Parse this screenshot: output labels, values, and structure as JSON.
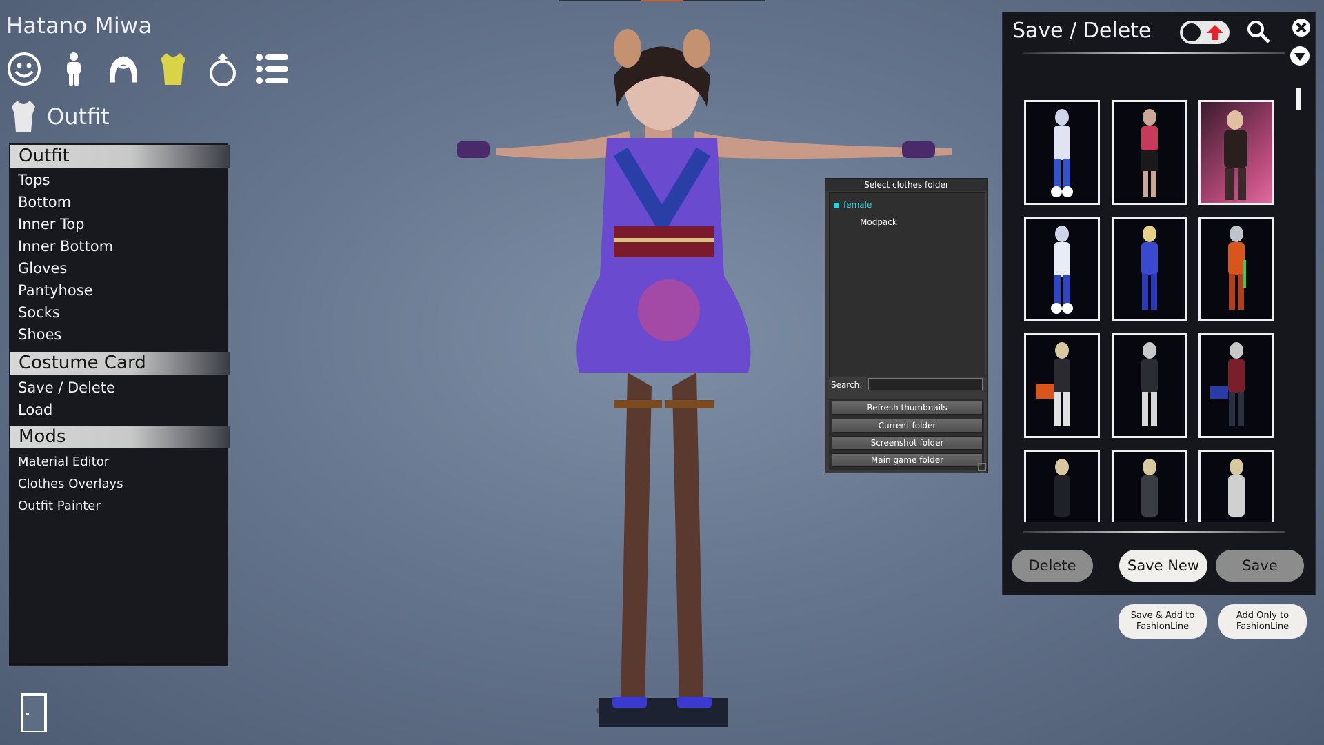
{
  "character_name": "Hatano Miwa",
  "category_icons": [
    {
      "name": "face-icon",
      "active": false
    },
    {
      "name": "body-icon",
      "active": false
    },
    {
      "name": "hair-icon",
      "active": false
    },
    {
      "name": "outfit-icon",
      "active": true
    },
    {
      "name": "accessory-ring-icon",
      "active": false
    },
    {
      "name": "list-icon",
      "active": false
    }
  ],
  "section": {
    "title": "Outfit",
    "icon": "outfit-icon"
  },
  "left_menu": {
    "group_outfit": "Outfit",
    "outfit_items": [
      "Tops",
      "Bottom",
      "Inner Top",
      "Inner Bottom",
      "Gloves",
      "Pantyhose",
      "Socks",
      "Shoes"
    ],
    "group_costume": "Costume Card",
    "costume_items": [
      "Save / Delete",
      "Load"
    ],
    "group_mods": "Mods",
    "mods_items": [
      "Material Editor",
      "Clothes Overlays",
      "Outfit Painter"
    ]
  },
  "folder_dialog": {
    "title": "Select clothes folder",
    "tree": [
      {
        "label": "female",
        "selected": true
      },
      {
        "label": "Modpack",
        "selected": false
      }
    ],
    "search_label": "Search:",
    "search_value": "",
    "buttons": [
      "Refresh thumbnails",
      "Current folder",
      "Screenshot folder",
      "Main game folder"
    ]
  },
  "save_panel": {
    "title": "Save / Delete",
    "thumbnails": [
      {
        "name": "bunny-white"
      },
      {
        "name": "red-jacket"
      },
      {
        "name": "pink-room",
        "style": "pink"
      },
      {
        "name": "bunny-blue"
      },
      {
        "name": "bunny-blonde"
      },
      {
        "name": "orange-suit"
      },
      {
        "name": "armor-orange"
      },
      {
        "name": "armor-white"
      },
      {
        "name": "armor-blue"
      },
      {
        "name": "dark-armor-1"
      },
      {
        "name": "dark-armor-2"
      },
      {
        "name": "dark-armor-3"
      }
    ],
    "delete_label": "Delete",
    "save_new_label": "Save New",
    "save_label": "Save"
  },
  "fashionline": {
    "save_add_label": "Save & Add to FashionLine",
    "add_only_label": "Add Only to FashionLine"
  },
  "colors": {
    "accent_yellow": "#d9d347",
    "selected_cyan": "#33d0e0"
  }
}
